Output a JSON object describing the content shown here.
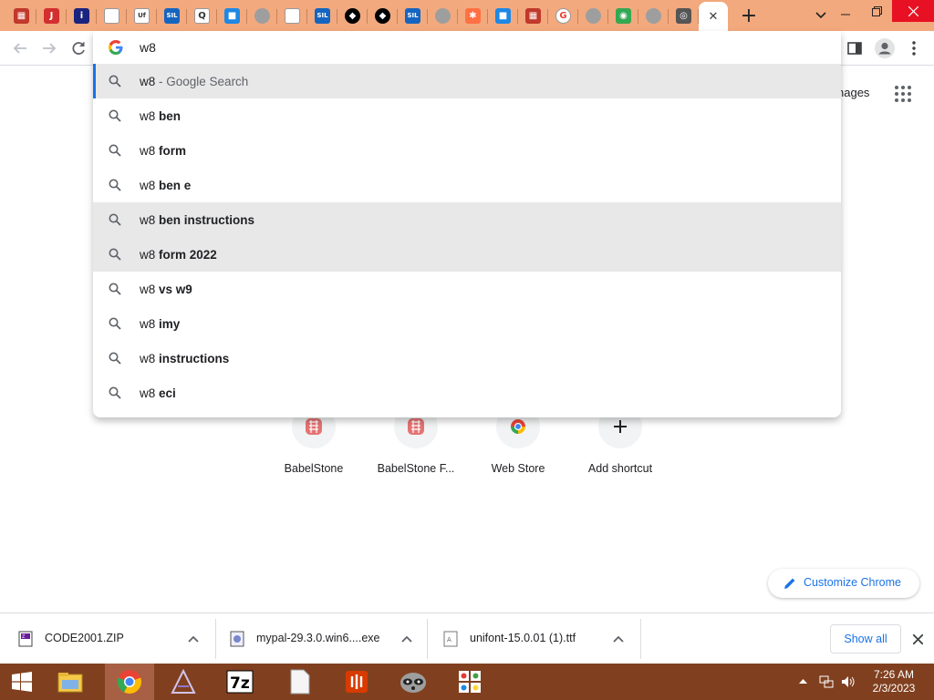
{
  "browser": {
    "tabs": [
      {
        "icon": "babelstone-icon",
        "color": "#c0392b"
      },
      {
        "icon": "j-red-icon",
        "color": "#d32f2f"
      },
      {
        "icon": "info-icon",
        "color": "#1a237e"
      },
      {
        "icon": "blank-icon",
        "color": "#ffffff"
      },
      {
        "icon": "uf-icon",
        "color": "#ffffff"
      },
      {
        "icon": "sil-icon",
        "color": "#1565c0"
      },
      {
        "icon": "q-icon",
        "color": "#ffffff"
      },
      {
        "icon": "colorful-icon",
        "color": "#1e88e5"
      },
      {
        "icon": "globe-icon",
        "color": "#777777"
      },
      {
        "icon": "document-icon",
        "color": "#ffffff"
      },
      {
        "icon": "sil-icon",
        "color": "#1565c0"
      },
      {
        "icon": "swoosh-icon",
        "color": "#000000"
      },
      {
        "icon": "swoosh-icon",
        "color": "#000000"
      },
      {
        "icon": "sil-icon",
        "color": "#1565c0"
      },
      {
        "icon": "globe-icon",
        "color": "#777777"
      },
      {
        "icon": "star-icon",
        "color": "#ff7043"
      },
      {
        "icon": "colorful-icon",
        "color": "#1e88e5"
      },
      {
        "icon": "babelstone-icon",
        "color": "#c0392b"
      },
      {
        "icon": "google-icon",
        "color": "#ffffff"
      },
      {
        "icon": "globe-icon",
        "color": "#777777"
      },
      {
        "icon": "maps-icon",
        "color": "#34a853"
      },
      {
        "icon": "globe-icon",
        "color": "#777777"
      },
      {
        "icon": "chrome-icon",
        "color": "#555555"
      }
    ],
    "active_tab_close": "✕",
    "new_tab": "+"
  },
  "omnibox": {
    "text": "w8",
    "suggestions": [
      {
        "prefix": "w8",
        "bold": "",
        "desc": " - Google Search",
        "state": "selected"
      },
      {
        "prefix": "w8 ",
        "bold": "ben",
        "desc": "",
        "state": "normal"
      },
      {
        "prefix": "w8 ",
        "bold": "form",
        "desc": "",
        "state": "normal"
      },
      {
        "prefix": "w8 ",
        "bold": "ben e",
        "desc": "",
        "state": "normal"
      },
      {
        "prefix": "w8 ",
        "bold": "ben instructions",
        "desc": "",
        "state": "hover"
      },
      {
        "prefix": "w8 ",
        "bold": "form 2022",
        "desc": "",
        "state": "hover"
      },
      {
        "prefix": "w8 ",
        "bold": "vs w9",
        "desc": "",
        "state": "normal"
      },
      {
        "prefix": "w8 ",
        "bold": "imy",
        "desc": "",
        "state": "normal"
      },
      {
        "prefix": "w8 ",
        "bold": "instructions",
        "desc": "",
        "state": "normal"
      },
      {
        "prefix": "w8 ",
        "bold": "eci",
        "desc": "",
        "state": "normal"
      }
    ]
  },
  "ntp": {
    "images_link": "nages",
    "shortcuts": [
      {
        "label": "BabelStone",
        "icon": "babelstone-icon"
      },
      {
        "label": "BabelStone F...",
        "icon": "babelstone-icon"
      },
      {
        "label": "Web Store",
        "icon": "chrome-web-store-icon"
      },
      {
        "label": "Add shortcut",
        "icon": "plus-icon"
      }
    ],
    "customize_label": "Customize Chrome"
  },
  "downloads": {
    "items": [
      {
        "name": "CODE2001.ZIP",
        "icon": "zip-file-icon"
      },
      {
        "name": "mypal-29.3.0.win6....exe",
        "icon": "exe-file-icon"
      },
      {
        "name": "unifont-15.0.01 (1).ttf",
        "icon": "font-file-icon"
      }
    ],
    "show_all": "Show all"
  },
  "taskbar": {
    "apps": [
      {
        "name": "file-explorer-icon"
      },
      {
        "name": "chrome-icon"
      },
      {
        "name": "app-a-icon"
      },
      {
        "name": "7zip-icon"
      },
      {
        "name": "blank-file-icon"
      },
      {
        "name": "office-icon"
      },
      {
        "name": "raccoon-icon"
      },
      {
        "name": "grid-app-icon"
      }
    ],
    "time": "7:26 AM",
    "date": "2/3/2023"
  }
}
